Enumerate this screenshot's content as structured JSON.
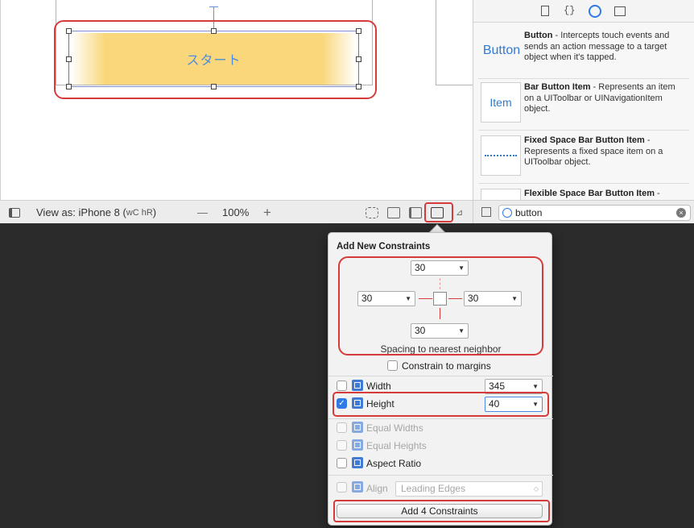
{
  "canvas": {
    "button_title": "スタート"
  },
  "bottom_bar": {
    "view_as": "View as: iPhone 8 (",
    "size_class": "wC hR",
    "view_as_close": ")",
    "zoom_out": "—",
    "zoom": "100%",
    "zoom_in": "+"
  },
  "library": {
    "items": [
      {
        "thumb": "Button",
        "title": "Button",
        "desc": " - Intercepts touch events and sends an action message to a target object when it's tapped."
      },
      {
        "thumb": "Item",
        "title": "Bar Button Item",
        "desc": " - Represents an item on a UIToolbar or UINavigationItem object."
      },
      {
        "thumb": "",
        "title": "Fixed Space Bar Button Item",
        "desc": " - Represents a fixed space item on a UIToolbar object."
      },
      {
        "thumb": "",
        "title": "Flexible Space Bar Button Item",
        "desc": " -"
      }
    ],
    "filter_value": "button"
  },
  "popover": {
    "title": "Add New Constraints",
    "spacing": {
      "top": "30",
      "left": "30",
      "right": "30",
      "bottom": "30"
    },
    "spacing_caption": "Spacing to nearest neighbor",
    "constrain_margins": "Constrain to margins",
    "width_label": "Width",
    "width_value": "345",
    "height_label": "Height",
    "height_value": "40",
    "equal_widths": "Equal Widths",
    "equal_heights": "Equal Heights",
    "aspect_ratio": "Aspect Ratio",
    "align_label": "Align",
    "align_value": "Leading Edges",
    "add_button": "Add 4 Constraints"
  },
  "colors": {
    "highlight": "#d63b3b",
    "accent": "#2f7ae5",
    "button_fill": "#f9d77a",
    "button_text": "#4b8de0"
  }
}
